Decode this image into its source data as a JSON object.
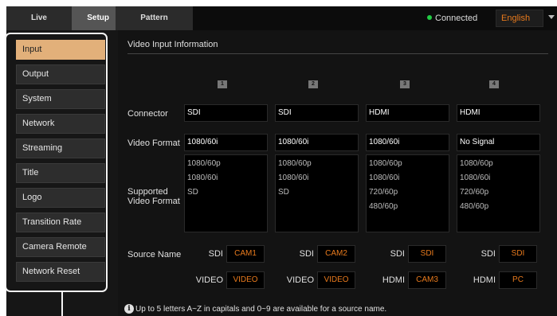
{
  "tabs": {
    "live": "Live",
    "setup": "Setup",
    "pattern": "Pattern"
  },
  "status": {
    "connected": "Connected"
  },
  "language": {
    "selected": "English"
  },
  "sidebar": {
    "items": [
      "Input",
      "Output",
      "System",
      "Network",
      "Streaming",
      "Title",
      "Logo",
      "Transition Rate",
      "Camera Remote",
      "Network Reset"
    ],
    "active": "Input"
  },
  "main": {
    "section_title": "Video Input Information",
    "columns": [
      "1",
      "2",
      "3",
      "4"
    ],
    "labels": {
      "connector": "Connector",
      "video_format": "Video Format",
      "supported_line1": "Supported",
      "supported_line2": "Video Format",
      "source_name": "Source Name"
    },
    "connector": [
      "SDI",
      "SDI",
      "HDMI",
      "HDMI"
    ],
    "video_format": [
      "1080/60i",
      "1080/60i",
      "1080/60i",
      "No Signal"
    ],
    "supported": [
      [
        "1080/60p",
        "1080/60i",
        "SD"
      ],
      [
        "1080/60p",
        "1080/60i",
        "SD"
      ],
      [
        "1080/60p",
        "1080/60i",
        "720/60p",
        "480/60p"
      ],
      [
        "1080/60p",
        "1080/60i",
        "720/60p",
        "480/60p"
      ]
    ],
    "source_names": {
      "row1": [
        {
          "label": "SDI",
          "value": "CAM1"
        },
        {
          "label": "SDI",
          "value": "CAM2"
        },
        {
          "label": "SDI",
          "value": "SDI"
        },
        {
          "label": "SDI",
          "value": "SDI"
        }
      ],
      "row2": [
        {
          "label": "VIDEO",
          "value": "VIDEO"
        },
        {
          "label": "VIDEO",
          "value": "VIDEO"
        },
        {
          "label": "HDMI",
          "value": "CAM3"
        },
        {
          "label": "HDMI",
          "value": "PC"
        }
      ]
    },
    "note": "Up to 5 letters A~Z in capitals and 0~9 are available for a source name."
  },
  "colors": {
    "accent": "#e87a1d",
    "active_menu": "#e2b07a",
    "connected_dot": "#22cc44",
    "background": "#131313"
  },
  "icons": {
    "info": "info-icon",
    "language_caret": "chevron-down-icon",
    "status": "status-dot-icon"
  }
}
